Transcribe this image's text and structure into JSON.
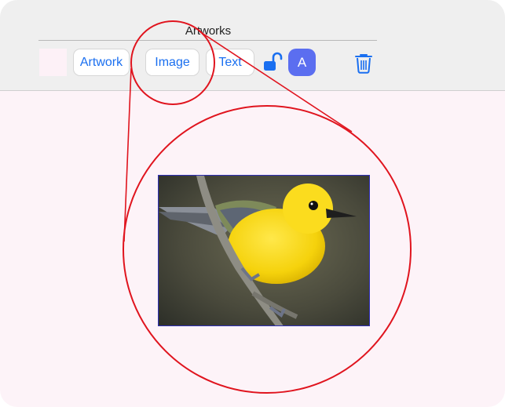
{
  "toolbar": {
    "title": "Artworks",
    "swatch_color": "#fdf1f7",
    "buttons": {
      "artwork": "Artwork",
      "image": "Image",
      "text": "Text"
    },
    "lock_icon": "unlocked-padlock-icon",
    "avatar_letter": "A",
    "trash_icon": "trash-icon"
  },
  "canvas": {
    "background": "#fdf3f8",
    "image_subject": "yellow-warbler-bird-on-branch"
  },
  "colors": {
    "accent": "#1a6ff0",
    "avatar": "#5b6ef0",
    "annotation": "#e0141e",
    "selection": "#2f2fb8"
  }
}
